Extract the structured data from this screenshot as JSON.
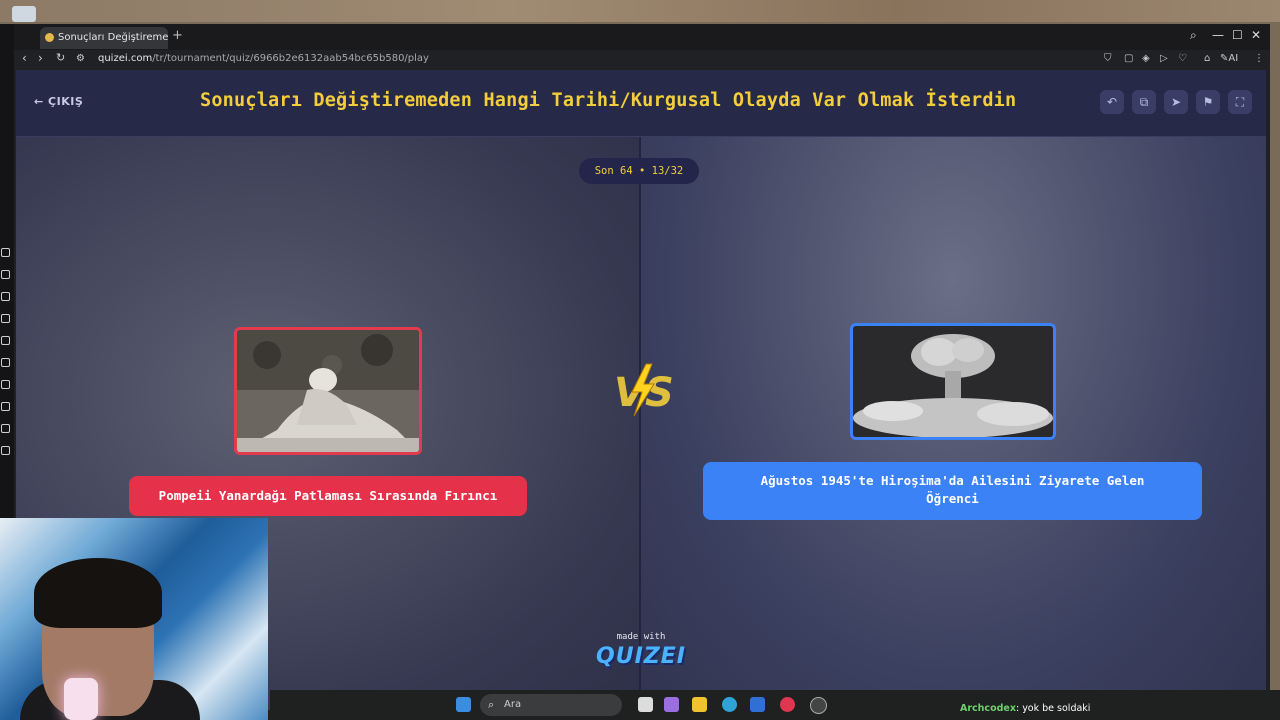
{
  "browser": {
    "tab_title": "Sonuçları Değiştiremeden",
    "new_tab": "+",
    "url_host": "quizei.com",
    "url_path": "/tr/tournament/quiz/6966b2e6132aab54bc65b580/play",
    "ext_ai": "AI"
  },
  "header": {
    "exit_label": "ÇIKIŞ",
    "title": "Sonuçları Değiştiremeden Hangi Tarihi/Kurgusal Olayda Var Olmak İsterdin"
  },
  "round": "Son 64 • 13/32",
  "left_option": {
    "label": "Pompeii Yanardağı Patlaması Sırasında Fırıncı",
    "accent": "#e5314a"
  },
  "right_option": {
    "label": "Ağustos 1945'te Hiroşima'da Ailesini Ziyarete Gelen Öğrenci",
    "accent": "#3b82f6"
  },
  "vs_text": "VS",
  "footer": {
    "made_with": "made with",
    "brand": "QUIZEI"
  },
  "taskbar": {
    "search_placeholder": "Ara"
  },
  "chat": {
    "user": "Archcodex",
    "message": ": yok be soldaki"
  },
  "icons": {
    "back": "back-arrow-icon",
    "undo": "undo-icon",
    "share": "share-icon",
    "send": "send-icon",
    "flag": "flag-icon",
    "fullscreen": "fullscreen-icon"
  }
}
